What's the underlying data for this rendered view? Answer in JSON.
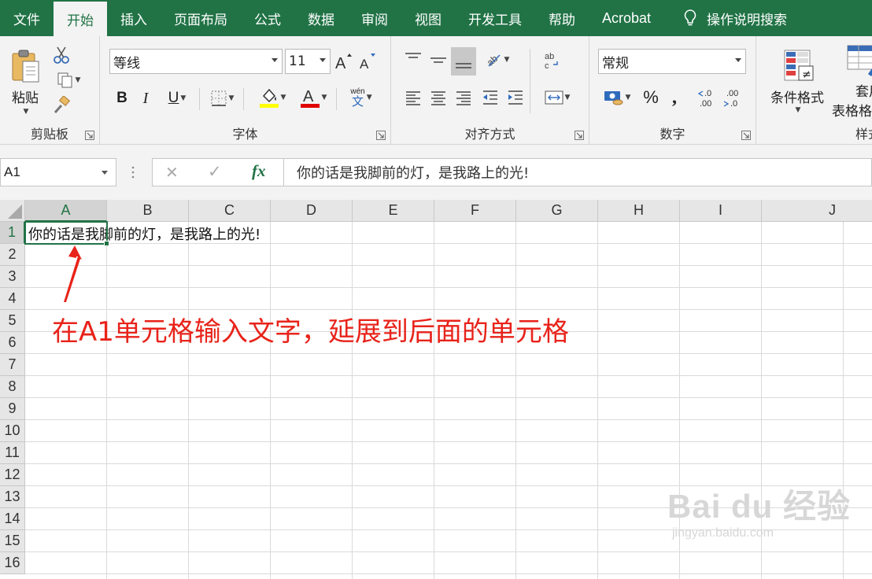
{
  "tabs": [
    {
      "label": "文件",
      "active": false
    },
    {
      "label": "开始",
      "active": true
    },
    {
      "label": "插入",
      "active": false
    },
    {
      "label": "页面布局",
      "active": false
    },
    {
      "label": "公式",
      "active": false
    },
    {
      "label": "数据",
      "active": false
    },
    {
      "label": "审阅",
      "active": false
    },
    {
      "label": "视图",
      "active": false
    },
    {
      "label": "开发工具",
      "active": false
    },
    {
      "label": "帮助",
      "active": false
    },
    {
      "label": "Acrobat",
      "active": false
    }
  ],
  "tell_me": {
    "label": "操作说明搜索",
    "icon": "lightbulb-icon"
  },
  "ribbon": {
    "clipboard": {
      "label": "剪贴板",
      "paste_label": "粘贴"
    },
    "font": {
      "label": "字体",
      "font_name": "等线",
      "font_size": "11",
      "bold": "B",
      "italic": "I",
      "underline": "U",
      "phonetic_top": "wén",
      "phonetic_bottom": "文",
      "fill_color": "#ffff00",
      "font_color": "#e00000"
    },
    "alignment": {
      "label": "对齐方式"
    },
    "number": {
      "label": "数字",
      "format": "常规",
      "percent": "%",
      "comma": ","
    },
    "styles": {
      "label": "样式",
      "conditional_format": "条件格式",
      "table_format_line1": "套用",
      "table_format_line2": "表格格"
    }
  },
  "formula_bar": {
    "name_box": "A1",
    "cancel": "✕",
    "enter": "✓",
    "fx": "fx",
    "formula": "你的话是我脚前的灯，是我路上的光!"
  },
  "sheet": {
    "columns": [
      "A",
      "B",
      "C",
      "D",
      "E",
      "F",
      "G",
      "H",
      "I",
      "J"
    ],
    "rows": [
      "1",
      "2",
      "3",
      "4",
      "5",
      "6",
      "7",
      "8",
      "9",
      "10",
      "11",
      "12",
      "13",
      "14",
      "15",
      "16"
    ],
    "selected_cell": "A1",
    "a1_value": "你的话是我脚前的灯，是我路上的光!"
  },
  "annotation": {
    "text": "在A1单元格输入文字，延展到后面的单元格",
    "color": "#e8231a"
  },
  "watermark": {
    "main": "Bai du 经验",
    "sub": "jingyan.baidu.com"
  },
  "colors": {
    "accent": "#217346",
    "ribbon_bg": "#f3f3f3",
    "header_bg": "#e6e6e6"
  }
}
